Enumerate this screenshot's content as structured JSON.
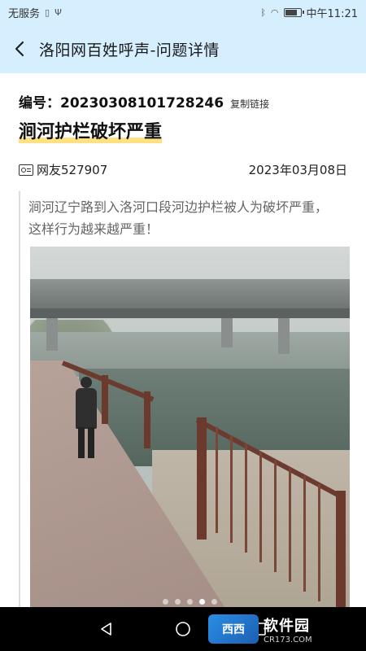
{
  "status_bar": {
    "carrier": "无服务",
    "time": "中午11:21"
  },
  "header": {
    "title": "洛阳网百姓呼声-问题详情"
  },
  "issue": {
    "id_label": "编号：",
    "id_value": "20230308101728246",
    "copy_link_label": "复制链接",
    "title": "涧河护栏破坏严重",
    "author": "网友527907",
    "date": "2023年03月08日",
    "description": "涧河辽宁路到入洛河口段河边护栏被人为破坏严重，这样行为越来越严重！"
  },
  "carousel": {
    "total": 5,
    "active_index": 3
  },
  "watermark": {
    "logo": "西西",
    "main": "软件园",
    "sub": "CR173.COM"
  },
  "colors": {
    "header_bg": "#d6efff",
    "title_highlight": "#ffd65a",
    "nav_bg": "#000000"
  },
  "icons": [
    "back-arrow-icon",
    "user-card-icon",
    "nav-back-icon",
    "nav-home-icon",
    "nav-recents-icon",
    "bluetooth-icon",
    "wifi-icon",
    "battery-icon"
  ]
}
